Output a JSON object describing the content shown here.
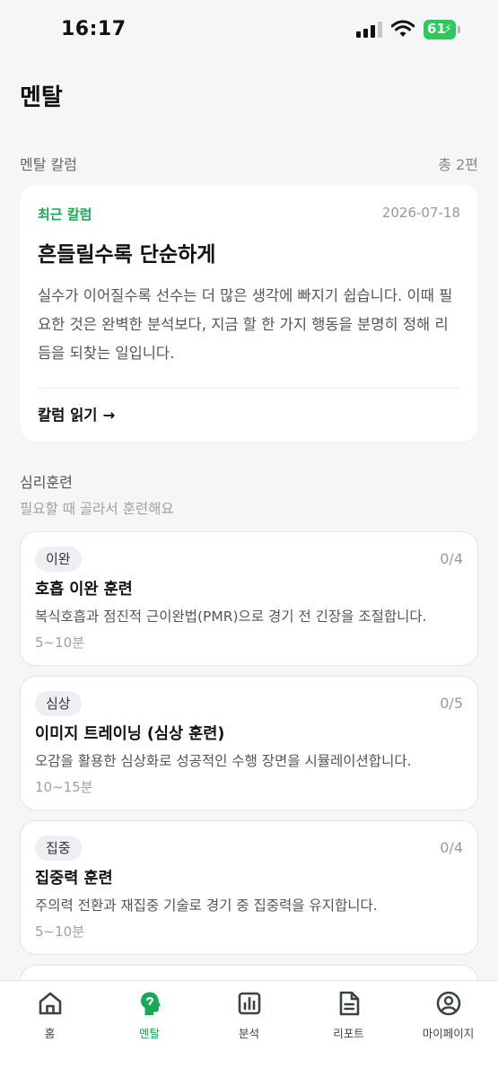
{
  "status_bar": {
    "time": "16:17",
    "battery": "61"
  },
  "page_title": "멘탈",
  "column_section": {
    "label": "멘탈 칼럼",
    "count": "총 2편"
  },
  "column_card": {
    "tag": "최근 칼럼",
    "date": "2026-07-18",
    "title": "흔들릴수록 단순하게",
    "body": "실수가 이어질수록 선수는 더 많은 생각에 빠지기 쉽습니다. 이때 필요한 것은 완벽한 분석보다, 지금 할 한 가지 행동을 분명히 정해 리듬을 되찾는 일입니다.",
    "read_label": "칼럼 읽기",
    "read_arrow": "→"
  },
  "training_section": {
    "title": "심리훈련",
    "subtitle": "필요할 때 골라서 훈련해요"
  },
  "trainings": [
    {
      "badge": "이완",
      "progress": "0/4",
      "name": "호흡 이완 훈련",
      "desc": "복식호흡과 점진적 근이완법(PMR)으로 경기 전 긴장을 조절합니다.",
      "duration": "5~10분"
    },
    {
      "badge": "심상",
      "progress": "0/5",
      "name": "이미지 트레이닝 (심상 훈련)",
      "desc": "오감을 활용한 심상화로 성공적인 수행 장면을 시뮬레이션합니다.",
      "duration": "10~15분"
    },
    {
      "badge": "집중",
      "progress": "0/4",
      "name": "집중력 훈련",
      "desc": "주의력 전환과 재집중 기술로 경기 중 집중력을 유지합니다.",
      "duration": "5~10분"
    }
  ],
  "tabs": [
    {
      "label": "홈",
      "icon": "home-icon"
    },
    {
      "label": "멘탈",
      "icon": "mind-icon",
      "active": true
    },
    {
      "label": "분석",
      "icon": "chart-icon"
    },
    {
      "label": "리포트",
      "icon": "report-icon"
    },
    {
      "label": "마이페이지",
      "icon": "profile-icon"
    }
  ],
  "colors": {
    "accent": "#18a957",
    "battery": "#2fc95b",
    "background": "#f5f6f8"
  }
}
